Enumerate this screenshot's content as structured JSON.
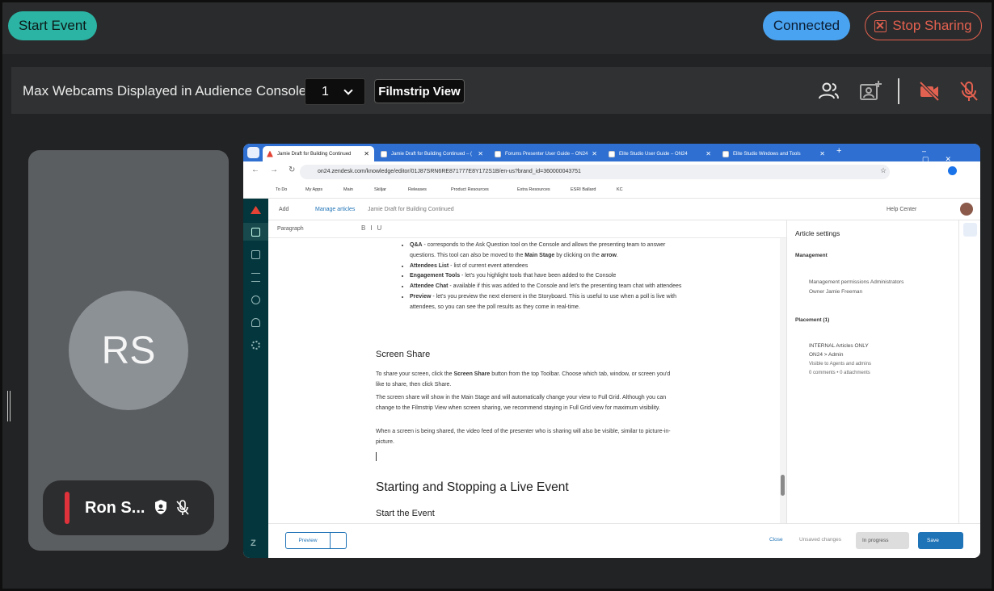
{
  "topbar": {
    "start_label": "Start Event",
    "connected_label": "Connected",
    "stop_label": "Stop Sharing",
    "colors": {
      "start": "#2bb3a3",
      "connected": "#4aa3f0",
      "stop": "#e36150"
    }
  },
  "toolbar": {
    "webcams_label": "Max Webcams Displayed in Audience Console:",
    "webcams_value": "1",
    "view_label": "Filmstrip View",
    "icons": [
      "attendees-icon",
      "add-webcam-icon",
      "camera-off-icon",
      "mic-off-icon"
    ]
  },
  "presenter": {
    "initials": "RS",
    "name": "Ron S...",
    "icons": [
      "shield-icon",
      "mic-off-icon"
    ]
  },
  "shared_screen": {
    "tabs": [
      {
        "label": "Jamie Draft for Building Continued",
        "active": true
      },
      {
        "label": "Jamie Draft for Building Continued – ("
      },
      {
        "label": "Forums Presenter User Guide – ON24"
      },
      {
        "label": "Elite Studio User Guide – ON24"
      },
      {
        "label": "Elite Studio Windows and Tools"
      }
    ],
    "url": "on24.zendesk.com/knowledge/editor/01J87SRN6RE871777E8Y172S1B/en-us?brand_id=360000043751",
    "bookmarks": [
      "To Do",
      "My Apps",
      "Main",
      "Skiljar",
      "Releases",
      "Product Resources",
      "Extra Resources",
      "ESRI Ballard",
      "KC"
    ],
    "header": {
      "add": "Add",
      "manage": "Manage articles",
      "crumb": "Jamie Draft for Building Continued",
      "help": "Help Center"
    },
    "paragraph_style": "Paragraph",
    "bullets": [
      {
        "bold": "Q&A",
        "text": " - corresponds to the Ask Question tool on the Console and allows the presenting team to answer questions.  This tool can also be moved to the ",
        "bold2": "Main Stage",
        "text2": " by clicking on the ",
        "bold3": "arrow",
        "text3": "."
      },
      {
        "bold": "Attendees List",
        "text": " - list of current event attendees"
      },
      {
        "bold": "Engagement Tools",
        "text": " - let's you highlight tools that have been added to the Console"
      },
      {
        "bold": "Attendee Chat",
        "text": " - available if this was added to the Console and let's the presenting team chat with attendees"
      },
      {
        "bold": "Preview",
        "text": " - let's you preview the next element in the Storyboard.  This is useful to use when a poll is live with attendees, so you can see the poll results as they come in real-time."
      }
    ],
    "screen_share_heading": "Screen Share",
    "p1_pre": "To share your screen, click the ",
    "p1_bold": "Screen Share",
    "p1_post": " button from the top Toolbar.  Choose which tab, window, or screen you'd like to share, then click Share.",
    "p2": "The screen share will show in the Main Stage and will automatically change your view to Full Grid. Although you can change to the Filmstrip View when screen sharing, we recommend staying in Full Grid view for maximum visibility.",
    "p3": "When a screen is being shared, the video feed of the presenter who is sharing will also be visible, similar to picture-in-picture.",
    "big_heading": "Starting and Stopping a Live Event",
    "sub_heading": "Start the Event",
    "settings": {
      "title": "Article settings",
      "management": "Management",
      "permissions": "Management permissions Administrators",
      "owner": "Owner Jamie Freeman",
      "placement": "Placement (1)",
      "section": "INTERNAL Articles ONLY",
      "path_a": "ON24",
      "path_b": "Admin",
      "visible": "Visible to Agents and admins",
      "counts": "0 comments • 0 attachments"
    },
    "footer": {
      "preview": "Preview",
      "close": "Close",
      "unsaved": "Unsaved changes",
      "status": "In progress",
      "save": "Save"
    }
  }
}
